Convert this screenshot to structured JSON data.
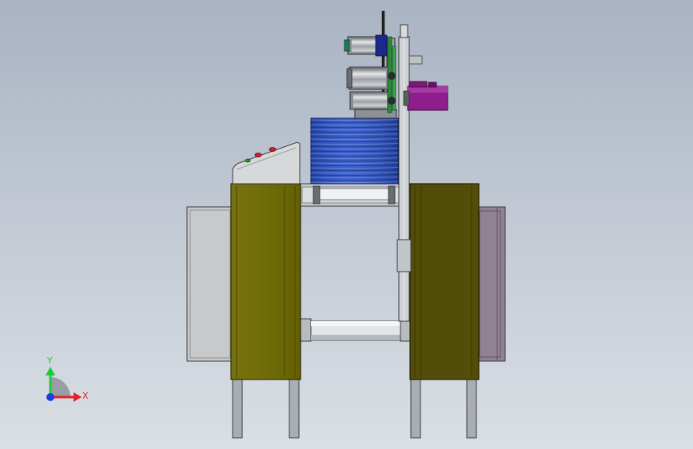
{
  "triad": {
    "y_label": "Y",
    "x_label": "X",
    "colors": {
      "y_axis": "#1ecb3a",
      "x_axis": "#e8202a",
      "z_axis": "#1a3fe0",
      "background_grad_top": "#a9b3c2",
      "background_grad_bottom": "#dadfe5"
    }
  }
}
